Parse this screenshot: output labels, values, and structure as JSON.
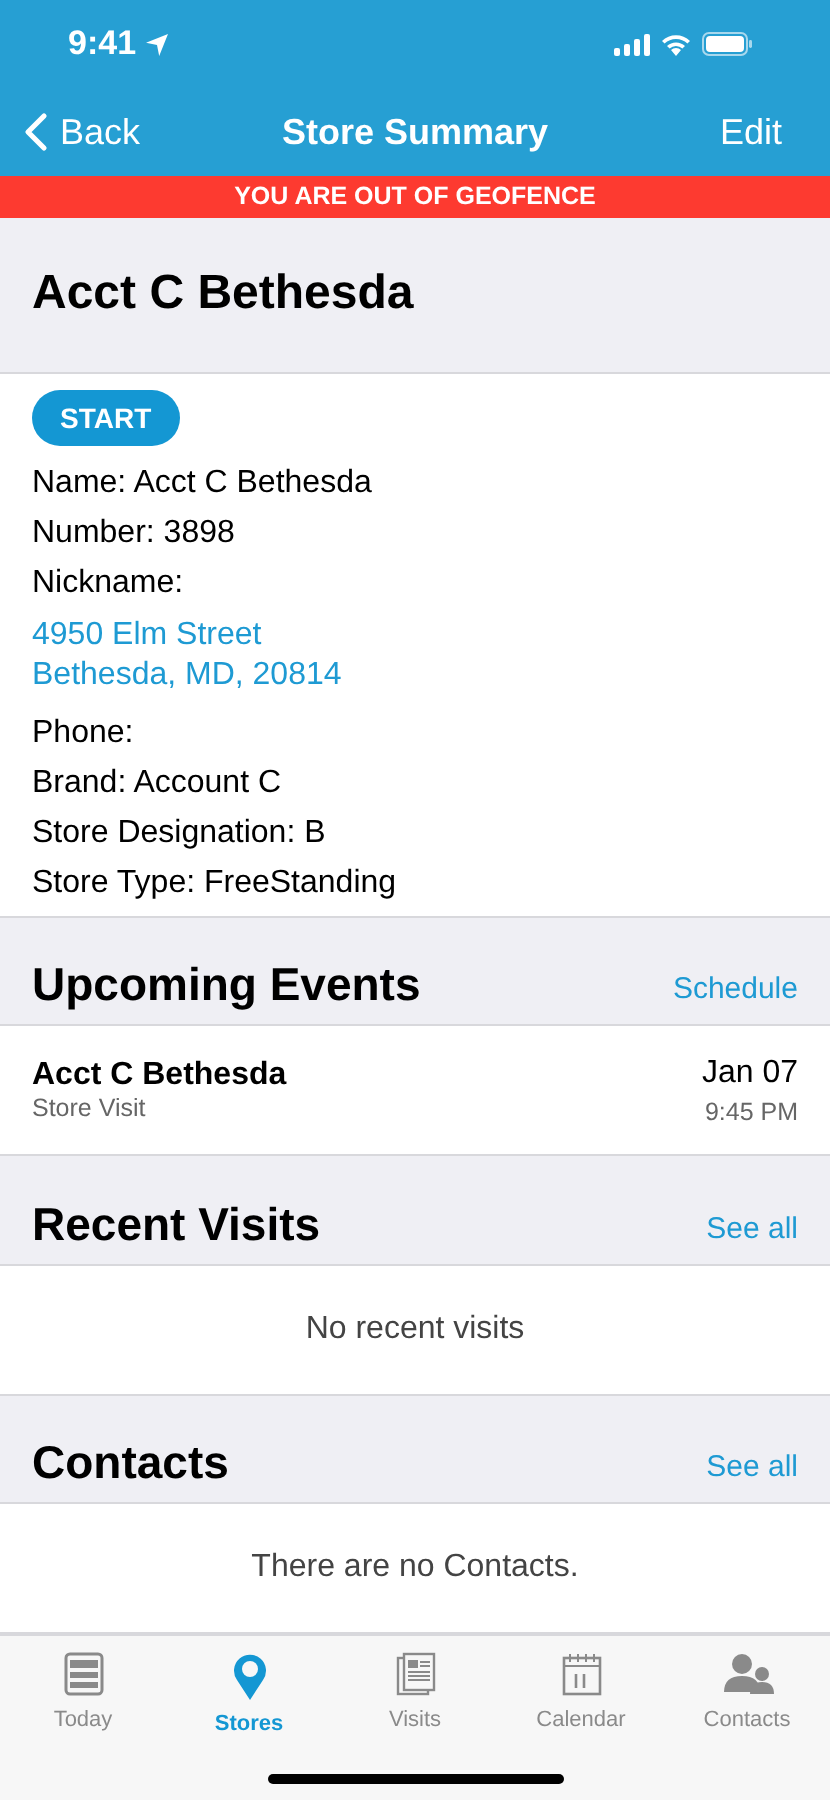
{
  "status_bar": {
    "time": "9:41"
  },
  "nav": {
    "back": "Back",
    "title": "Store Summary",
    "action": "Edit"
  },
  "banner": "YOU ARE OUT OF GEOFENCE",
  "store": {
    "title": "Acct C Bethesda",
    "start_button": "START",
    "details": [
      {
        "kind": "text",
        "text": "Name: Acct C Bethesda"
      },
      {
        "kind": "text",
        "text": "Number: 3898"
      },
      {
        "kind": "text",
        "text": "Nickname:"
      },
      {
        "kind": "link",
        "lines": [
          "4950 Elm Street",
          "Bethesda, MD, 20814"
        ]
      },
      {
        "kind": "text",
        "text": "Phone:"
      },
      {
        "kind": "text",
        "text": "Brand: Account C"
      },
      {
        "kind": "text",
        "text": "Store Designation: B"
      },
      {
        "kind": "text",
        "text": "Store Type: FreeStanding"
      }
    ]
  },
  "sections": [
    {
      "title": "Upcoming Events",
      "action": "Schedule",
      "events": [
        {
          "name": "Acct C Bethesda",
          "type": "Store Visit",
          "date": "Jan 07",
          "time": "9:45 PM"
        }
      ]
    },
    {
      "title": "Recent Visits",
      "action": "See all",
      "empty": "No recent visits"
    },
    {
      "title": "Contacts",
      "action": "See all",
      "empty": "There are no Contacts."
    }
  ],
  "tab_bar": [
    {
      "kind": "today",
      "label": "Today",
      "selected": false
    },
    {
      "kind": "stores",
      "label": "Stores",
      "selected": true
    },
    {
      "kind": "visits",
      "label": "Visits",
      "selected": false
    },
    {
      "kind": "calendar",
      "label": "Calendar",
      "selected": false
    },
    {
      "kind": "contacts",
      "label": "Contacts",
      "selected": false
    }
  ]
}
